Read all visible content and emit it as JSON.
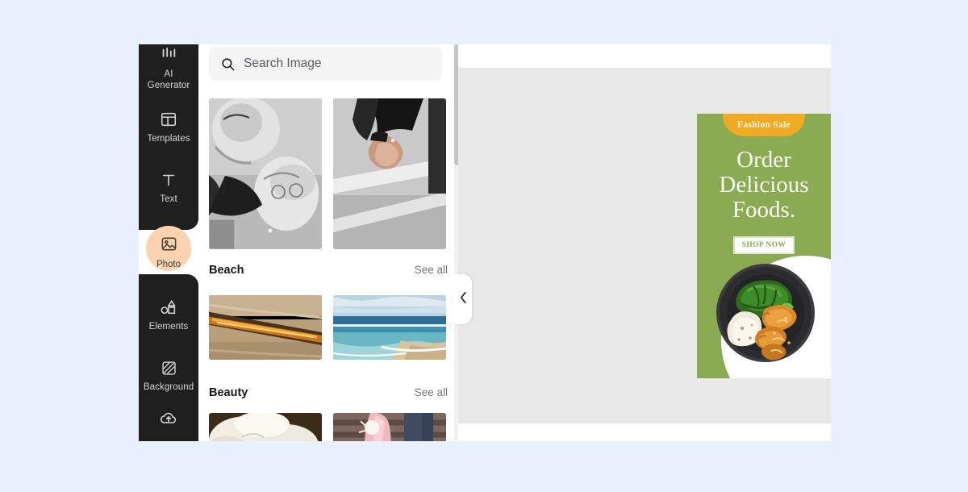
{
  "page": {
    "background_color": "#eaf1fe",
    "app_background": "#ffffff"
  },
  "sidebar": {
    "background_color": "#1f1f1f",
    "active_accent": "#fbd3b0",
    "items": [
      {
        "id": "ai-generator",
        "label_line1": "AI",
        "label_line2": "Generator",
        "icon": "ai-generator-icon",
        "active": false
      },
      {
        "id": "templates",
        "label": "Templates",
        "icon": "templates-icon",
        "active": false
      },
      {
        "id": "text",
        "label": "Text",
        "icon": "text-icon",
        "active": false
      },
      {
        "id": "photo",
        "label": "Photo",
        "icon": "photo-icon",
        "active": true
      },
      {
        "id": "elements",
        "label": "Elements",
        "icon": "elements-icon",
        "active": false
      },
      {
        "id": "background",
        "label": "Background",
        "icon": "background-icon",
        "active": false
      },
      {
        "id": "upload",
        "label": "",
        "icon": "cloud-upload-icon",
        "active": false
      }
    ]
  },
  "panel": {
    "search": {
      "placeholder": "Search Image",
      "value": "",
      "icon": "search-icon"
    },
    "sections": [
      {
        "id": "top-results",
        "title": "",
        "see_all": "",
        "images": [
          {
            "name": "elderly-couple-bw-photo",
            "alt": "Black and white elderly couple"
          },
          {
            "name": "holding-hands-bw-photo",
            "alt": "Two people holding hands"
          }
        ]
      },
      {
        "id": "beach",
        "title": "Beach",
        "see_all": "See all",
        "images": [
          {
            "name": "golden-driftwood-photo",
            "alt": "Golden driftwood on sand"
          },
          {
            "name": "ocean-shoreline-photo",
            "alt": "Blue ocean shoreline"
          }
        ]
      },
      {
        "id": "beauty",
        "title": "Beauty",
        "see_all": "See all",
        "images": [
          {
            "name": "white-flower-photo",
            "alt": "White magnolia flower"
          },
          {
            "name": "pink-dress-photo",
            "alt": "Person in pink dress with bouquet"
          }
        ]
      }
    ],
    "collapse_button": {
      "icon": "chevron-left-icon",
      "label": ""
    }
  },
  "canvas": {
    "background_color": "#e8e8e8",
    "poster": {
      "background_color": "#8aab52",
      "badge": {
        "text": "Fashion Sale",
        "color": "#f0ab22"
      },
      "headline": "Order Delicious Foods.",
      "cta": {
        "label": "SHOP NOW",
        "text_color": "#8aab52"
      },
      "image": {
        "name": "food-plate-photo",
        "alt": "Plate with greens, mashed potatoes and fried chicken tenders"
      }
    }
  }
}
